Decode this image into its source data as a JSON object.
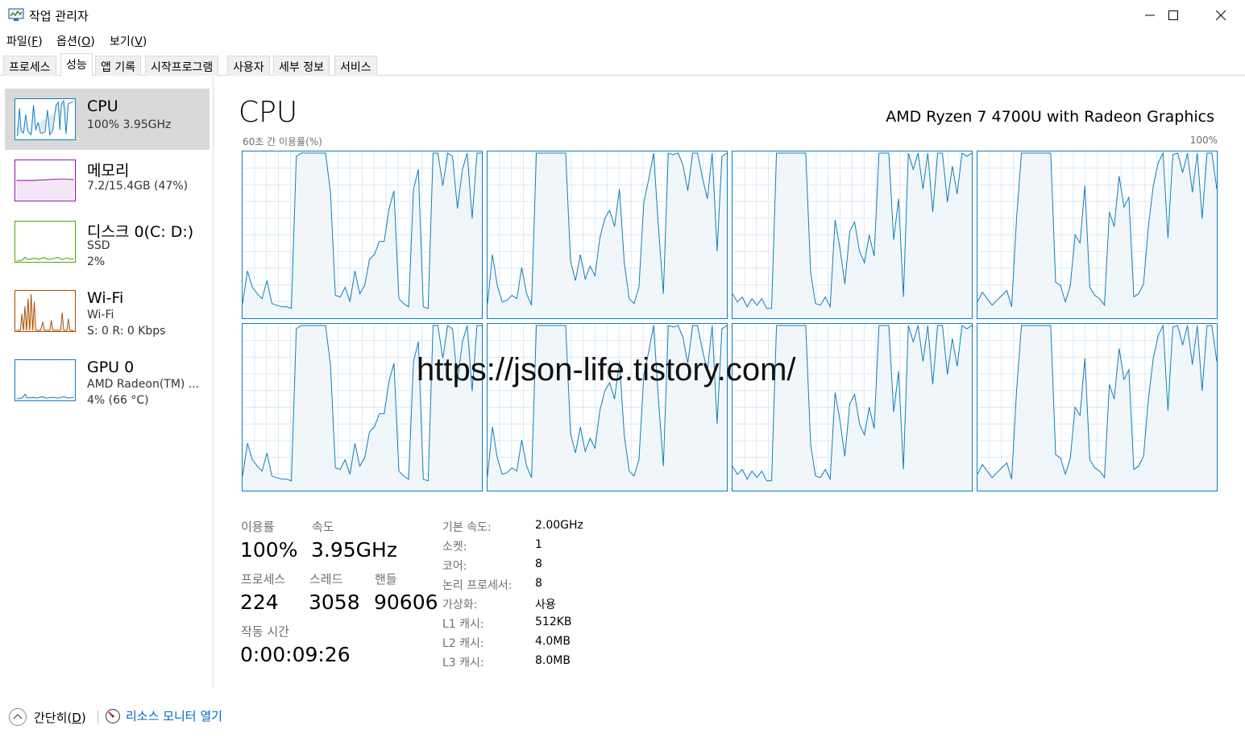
{
  "window": {
    "title": "작업 관리자",
    "icon": "task-manager-icon"
  },
  "menu": [
    {
      "label": "파일(",
      "key": "F",
      "suffix": ")"
    },
    {
      "label": "옵션(",
      "key": "O",
      "suffix": ")"
    },
    {
      "label": "보기(",
      "key": "V",
      "suffix": ")"
    }
  ],
  "tabs": [
    "프로세스",
    "성능",
    "앱 기록",
    "시작프로그램",
    "사용자",
    "세부 정보",
    "서비스"
  ],
  "active_tab": "성능",
  "resources": {
    "cpu": {
      "name": "CPU",
      "line1": "100%  3.95GHz",
      "color": "#117dbb"
    },
    "memory": {
      "name": "메모리",
      "line1": "7.2/15.4GB (47%)",
      "color": "#8b12ae"
    },
    "disk": {
      "name": "디스크 0(C: D:)",
      "line1": "SSD",
      "line2": "2%",
      "color": "#4da60c"
    },
    "wifi": {
      "name": "Wi-Fi",
      "line1": "Wi-Fi",
      "line2": "S: 0  R: 0 Kbps",
      "color": "#a74f01"
    },
    "gpu": {
      "name": "GPU 0",
      "line1": "AMD Radeon(TM) ...",
      "line2": "4% (66 °C)",
      "color": "#117dbb"
    }
  },
  "main": {
    "title": "CPU",
    "model": "AMD Ryzen 7 4700U with Radeon Graphics",
    "axis_left": "60초 간 이용률(%)",
    "axis_right": "100%"
  },
  "watermark": "https://json-life.tistory.com/",
  "stats": {
    "utilization_label": "이용률",
    "utilization": "100%",
    "speed_label": "속도",
    "speed": "3.95GHz",
    "processes_label": "프로세스",
    "processes": "224",
    "threads_label": "스레드",
    "threads": "3058",
    "handles_label": "핸들",
    "handles": "90606",
    "uptime_label": "작동 시간",
    "uptime": "0:00:09:26"
  },
  "info": [
    {
      "label": "기본 속도:",
      "value": "2.00GHz"
    },
    {
      "label": "소켓:",
      "value": "1"
    },
    {
      "label": "코어:",
      "value": "8"
    },
    {
      "label": "논리 프로세서:",
      "value": "8"
    },
    {
      "label": "가상화:",
      "value": "사용"
    },
    {
      "label": "L1 캐시:",
      "value": "512KB"
    },
    {
      "label": "L2 캐시:",
      "value": "4.0MB"
    },
    {
      "label": "L3 캐시:",
      "value": "8.0MB"
    }
  ],
  "bottom": {
    "fewer_details": "간단히(",
    "fewer_key": "D",
    "fewer_suffix": ")",
    "open_resmon": "리소스 모니터 열기"
  },
  "core_graphs": [
    [
      8,
      28,
      18,
      14,
      11,
      22,
      8,
      7,
      6,
      6,
      5,
      98,
      100,
      100,
      100,
      100,
      100,
      100,
      76,
      13,
      12,
      18,
      9,
      28,
      14,
      19,
      35,
      38,
      46,
      46,
      66,
      77,
      11,
      8,
      6,
      78,
      90,
      6,
      5,
      100,
      100,
      80,
      100,
      98,
      66,
      90,
      100,
      60,
      100,
      100
    ],
    [
      8,
      38,
      19,
      9,
      10,
      13,
      11,
      30,
      14,
      7,
      100,
      100,
      100,
      100,
      100,
      100,
      100,
      34,
      22,
      38,
      23,
      31,
      25,
      48,
      60,
      65,
      55,
      78,
      33,
      11,
      8,
      18,
      70,
      84,
      100,
      55,
      14,
      100,
      99,
      100,
      93,
      77,
      100,
      100,
      85,
      72,
      100,
      40,
      98,
      100
    ],
    [
      14,
      9,
      12,
      6,
      11,
      7,
      11,
      5,
      5,
      100,
      100,
      100,
      100,
      100,
      100,
      100,
      27,
      8,
      7,
      12,
      6,
      59,
      42,
      20,
      52,
      58,
      40,
      33,
      50,
      37,
      100,
      100,
      100,
      47,
      72,
      12,
      100,
      90,
      100,
      78,
      100,
      64,
      100,
      100,
      70,
      92,
      75,
      100,
      98,
      100
    ],
    [
      9,
      15,
      11,
      7,
      10,
      13,
      16,
      6,
      60,
      100,
      100,
      100,
      100,
      100,
      100,
      100,
      21,
      19,
      9,
      19,
      50,
      45,
      80,
      18,
      13,
      11,
      7,
      64,
      55,
      86,
      67,
      73,
      12,
      14,
      20,
      55,
      80,
      94,
      100,
      48,
      99,
      100,
      88,
      100,
      76,
      100,
      60,
      100,
      100,
      78
    ]
  ]
}
